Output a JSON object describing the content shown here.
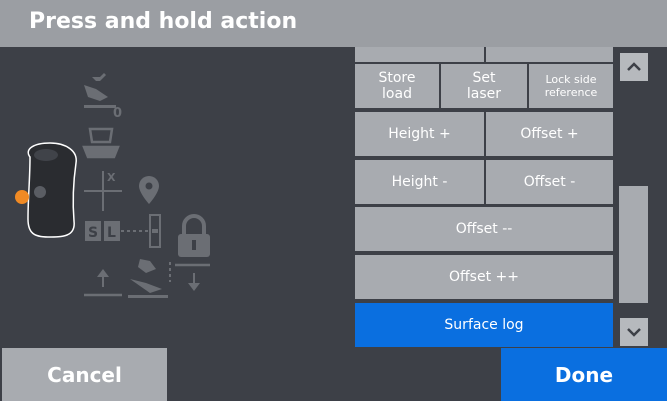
{
  "header": {
    "title": "Press and hold action"
  },
  "illustration": {
    "label_zero": "0",
    "label_x": "X",
    "label_s": "S",
    "label_l": "L"
  },
  "actions": {
    "store_load": "Store load",
    "set_laser": "Set laser",
    "lock_side_reference": "Lock side reference",
    "height_plus": "Height +",
    "offset_plus": "Offset +",
    "height_minus": "Height -",
    "offset_minus": "Offset -",
    "offset_minus_minus": "Offset --",
    "offset_plus_plus": "Offset ++",
    "surface_log": "Surface log"
  },
  "footer": {
    "cancel": "Cancel",
    "done": "Done"
  },
  "colors": {
    "accent": "#0a6fe0",
    "button": "#a8abb0",
    "background": "#3d4047",
    "handle_dot": "#f08a24"
  }
}
